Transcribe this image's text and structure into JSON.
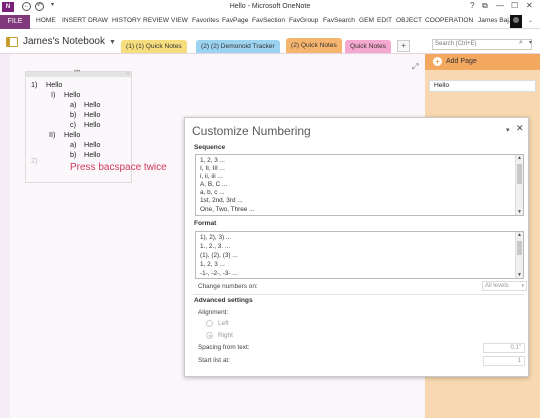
{
  "window": {
    "title": "Hello - Microsoft OneNote",
    "app_icon": "N",
    "controls": [
      "?",
      "⧉",
      "—",
      "☐",
      "✕"
    ]
  },
  "ribbon": {
    "file": "FILE",
    "tabs": [
      "HOME",
      "INSERT",
      "DRAW",
      "HISTORY",
      "REVIEW",
      "VIEW",
      "Favorites",
      "FavPage",
      "FavSection",
      "FavGroup",
      "FavSearch",
      "GEM",
      "EDIT",
      "OBJECT",
      "COOPERATION"
    ],
    "user": "James Baj..."
  },
  "notebook": {
    "name": "James's Notebook",
    "sections": [
      "(1) (1) Quick Notes",
      "(2) (2) Demonoid Tracker",
      "(2) Quick Notes",
      "Quick Notes"
    ],
    "search_placeholder": "Search (Ctrl+E)"
  },
  "outline": {
    "lines": [
      {
        "marker": "1)",
        "text": "Hello"
      },
      {
        "marker": "I)",
        "text": "Hello"
      },
      {
        "marker": "a)",
        "text": "Hello"
      },
      {
        "marker": "b)",
        "text": "Hello"
      },
      {
        "marker": "c)",
        "text": "Hello"
      },
      {
        "marker": "II)",
        "text": "Hello"
      },
      {
        "marker": "a)",
        "text": "Hello"
      },
      {
        "marker": "b)",
        "text": "Hello"
      }
    ],
    "next_marker": "2)",
    "hint": "Press bacspace twice"
  },
  "pages": {
    "add_page": "Add Page",
    "items": [
      "Hello"
    ]
  },
  "dialog": {
    "title": "Customize Numbering",
    "sequence_label": "Sequence",
    "sequence_items": [
      "1, 2, 3 ...",
      "I, II, III ...",
      "i, ii, iii ...",
      "A, B, C ...",
      "a, b, c ...",
      "1st, 2nd, 3rd ...",
      "One, Two, Three ..."
    ],
    "format_label": "Format",
    "format_items": [
      "1), 2), 3) ...",
      "1., 2., 3. ...",
      "(1), (2), (3) ...",
      "1, 2, 3 ...",
      "-1-, -2-, -3- ..."
    ],
    "change_numbers_label": "Change numbers on:",
    "change_numbers_value": "All levels",
    "advanced_label": "Advanced settings",
    "alignment_label": "Alignment:",
    "align_left": "Left",
    "align_right": "Right",
    "spacing_label": "Spacing from text:",
    "spacing_value": "0.1\"",
    "start_label": "Start list at:",
    "start_value": "1"
  }
}
